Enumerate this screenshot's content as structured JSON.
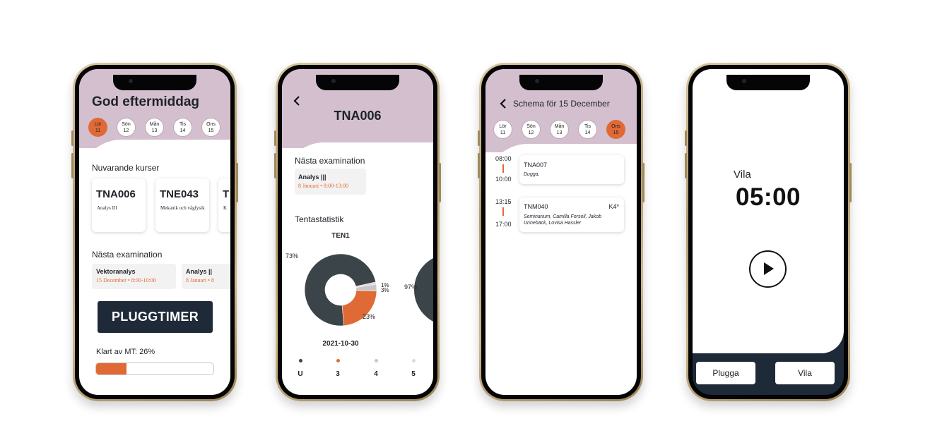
{
  "colors": {
    "accent": "#e06a35",
    "header": "#d4bfcf",
    "dark": "#1f2a38",
    "slate": "#3b4448"
  },
  "phone1": {
    "greeting": "God eftermiddag",
    "days": [
      {
        "name": "Lör",
        "num": "11",
        "active": true
      },
      {
        "name": "Sön",
        "num": "12",
        "active": false
      },
      {
        "name": "Mån",
        "num": "13",
        "active": false
      },
      {
        "name": "Tis",
        "num": "14",
        "active": false
      },
      {
        "name": "Ons",
        "num": "15",
        "active": false
      }
    ],
    "current_courses_title": "Nuvarande kurser",
    "courses": [
      {
        "code": "TNA006",
        "name": "Analys III"
      },
      {
        "code": "TNE043",
        "name": "Mekanik och vågfysik"
      },
      {
        "code": "T",
        "name": "K"
      }
    ],
    "next_exam_title": "Nästa examination",
    "exams": [
      {
        "name": "Vektoranalys",
        "when": "15 December • 8:00-10:00"
      },
      {
        "name": "Analys ||",
        "when": "8 Januari • 8"
      }
    ],
    "pluggtimer_label": "PLUGGTIMER",
    "progress_label": "Klart av MT: 26%",
    "progress_value": 0.26
  },
  "phone2": {
    "back_icon": "chevron-left-icon",
    "course_code": "TNA006",
    "next_exam_title": "Nästa examination",
    "exam_name": "Analys |||",
    "exam_when": "8 Januari • 8:00-13:00",
    "stats_title": "Tentastatistik",
    "chart_title": "TEN1",
    "chart_date": "2021-10-30",
    "next_chart_label": "97%"
  },
  "chart_data": {
    "type": "pie",
    "title": "TEN1",
    "categories": [
      "U",
      "3",
      "4",
      "5"
    ],
    "values": [
      73,
      23,
      3,
      1
    ],
    "value_labels": [
      "73%",
      "23%",
      "3%",
      "1%"
    ],
    "colors": [
      "#3b4448",
      "#e06a35",
      "#c7c7c7",
      "#e3d4dc"
    ],
    "donut": true,
    "legend": "bottom",
    "date": "2021-10-30"
  },
  "phone3": {
    "header_title": "Schema för 15 December",
    "days": [
      {
        "name": "Lör",
        "num": "11",
        "active": false
      },
      {
        "name": "Sön",
        "num": "12",
        "active": false
      },
      {
        "name": "Mån",
        "num": "13",
        "active": false
      },
      {
        "name": "Tis",
        "num": "14",
        "active": false
      },
      {
        "name": "Ons",
        "num": "15",
        "active": true
      }
    ],
    "events": [
      {
        "start": "08:00",
        "end": "10:00",
        "code": "TNA007",
        "room": "",
        "desc": "Dugga,"
      },
      {
        "start": "13:15",
        "end": "17:00",
        "code": "TNM040",
        "room": "K4*",
        "desc": "Seminarium, Camilla Forsell, Jakob Unnebäck, Lovisa Hassler"
      }
    ]
  },
  "phone4": {
    "mode_label": "Vila",
    "timer": "05:00",
    "play_icon": "play-icon",
    "tabs": [
      "Plugga",
      "Vila"
    ]
  }
}
